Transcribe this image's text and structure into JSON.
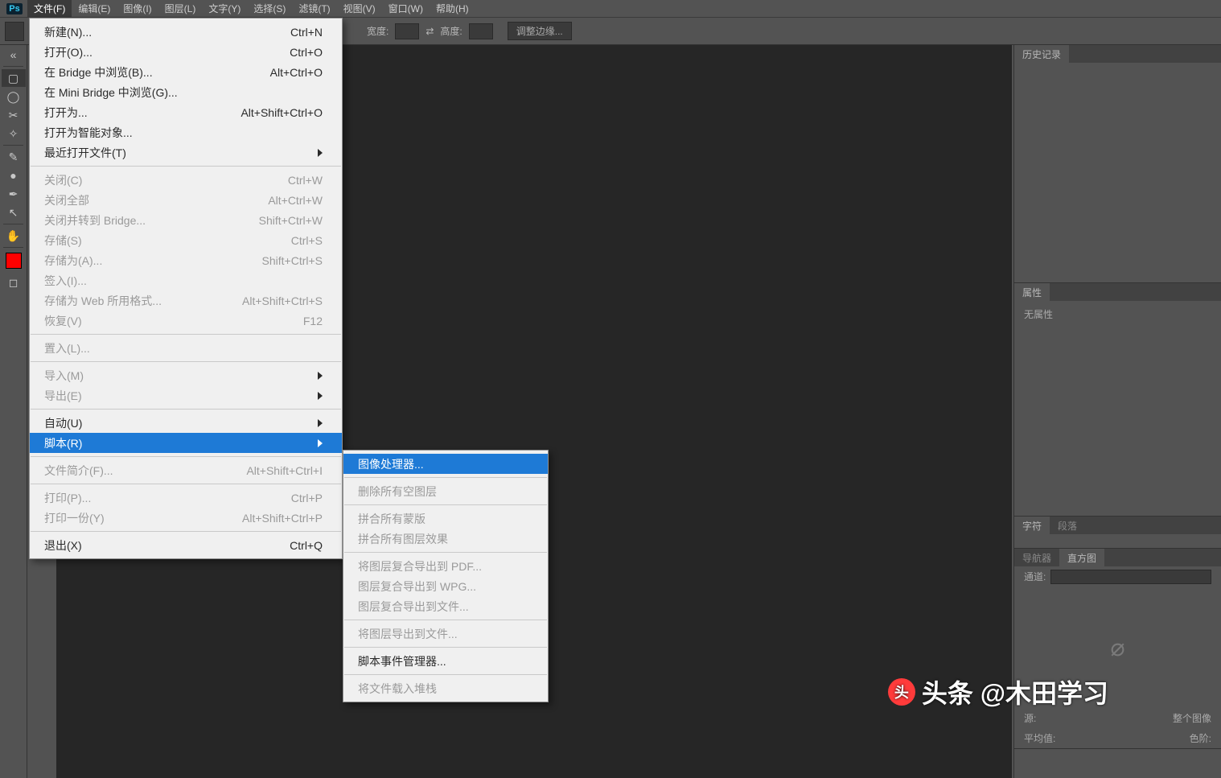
{
  "menubar": {
    "items": [
      "文件(F)",
      "编辑(E)",
      "图像(I)",
      "图层(L)",
      "文字(Y)",
      "选择(S)",
      "滤镜(T)",
      "视图(V)",
      "窗口(W)",
      "帮助(H)"
    ],
    "active_index": 0
  },
  "optionsbar": {
    "width_label": "宽度:",
    "height_label": "高度:",
    "swap_icon": "⇄",
    "adjust_button": "调整边缘..."
  },
  "file_menu": [
    {
      "t": "新建(N)...",
      "k": "Ctrl+N"
    },
    {
      "t": "打开(O)...",
      "k": "Ctrl+O"
    },
    {
      "t": "在 Bridge 中浏览(B)...",
      "k": "Alt+Ctrl+O"
    },
    {
      "t": "在 Mini Bridge 中浏览(G)..."
    },
    {
      "t": "打开为...",
      "k": "Alt+Shift+Ctrl+O"
    },
    {
      "t": "打开为智能对象..."
    },
    {
      "t": "最近打开文件(T)",
      "sub": true
    },
    {
      "hr": true
    },
    {
      "t": "关闭(C)",
      "k": "Ctrl+W",
      "dis": true
    },
    {
      "t": "关闭全部",
      "k": "Alt+Ctrl+W",
      "dis": true
    },
    {
      "t": "关闭并转到 Bridge...",
      "k": "Shift+Ctrl+W",
      "dis": true
    },
    {
      "t": "存储(S)",
      "k": "Ctrl+S",
      "dis": true
    },
    {
      "t": "存储为(A)...",
      "k": "Shift+Ctrl+S",
      "dis": true
    },
    {
      "t": "签入(I)...",
      "dis": true
    },
    {
      "t": "存储为 Web 所用格式...",
      "k": "Alt+Shift+Ctrl+S",
      "dis": true
    },
    {
      "t": "恢复(V)",
      "k": "F12",
      "dis": true
    },
    {
      "hr": true
    },
    {
      "t": "置入(L)...",
      "dis": true
    },
    {
      "hr": true
    },
    {
      "t": "导入(M)",
      "sub": true,
      "dis": true
    },
    {
      "t": "导出(E)",
      "sub": true,
      "dis": true
    },
    {
      "hr": true
    },
    {
      "t": "自动(U)",
      "sub": true
    },
    {
      "t": "脚本(R)",
      "sub": true,
      "hl": true
    },
    {
      "hr": true
    },
    {
      "t": "文件简介(F)...",
      "k": "Alt+Shift+Ctrl+I",
      "dis": true
    },
    {
      "hr": true
    },
    {
      "t": "打印(P)...",
      "k": "Ctrl+P",
      "dis": true
    },
    {
      "t": "打印一份(Y)",
      "k": "Alt+Shift+Ctrl+P",
      "dis": true
    },
    {
      "hr": true
    },
    {
      "t": "退出(X)",
      "k": "Ctrl+Q"
    }
  ],
  "script_submenu": [
    {
      "t": "图像处理器...",
      "hl": true
    },
    {
      "hr": true
    },
    {
      "t": "删除所有空图层",
      "dis": true
    },
    {
      "hr": true
    },
    {
      "t": "拼合所有蒙版",
      "dis": true
    },
    {
      "t": "拼合所有图层效果",
      "dis": true
    },
    {
      "hr": true
    },
    {
      "t": "将图层复合导出到 PDF...",
      "dis": true
    },
    {
      "t": "图层复合导出到 WPG...",
      "dis": true
    },
    {
      "t": "图层复合导出到文件...",
      "dis": true
    },
    {
      "hr": true
    },
    {
      "t": "将图层导出到文件...",
      "dis": true
    },
    {
      "hr": true
    },
    {
      "t": "脚本事件管理器..."
    },
    {
      "hr": true
    },
    {
      "t": "将文件载入堆栈",
      "dis": true
    }
  ],
  "panels": {
    "history_tab": "历史记录",
    "properties_tab": "属性",
    "no_properties": "无属性",
    "char_tab": "字符",
    "para_tab": "段落",
    "nav_tab": "导航器",
    "hist_tab": "直方图",
    "channel_label": "通道:",
    "source_label": "源:",
    "source_value": "整个图像",
    "mean_label": "平均值:",
    "levels_label": "色阶:"
  },
  "watermark": {
    "icon": "头",
    "text": "头条 @木田学习"
  }
}
